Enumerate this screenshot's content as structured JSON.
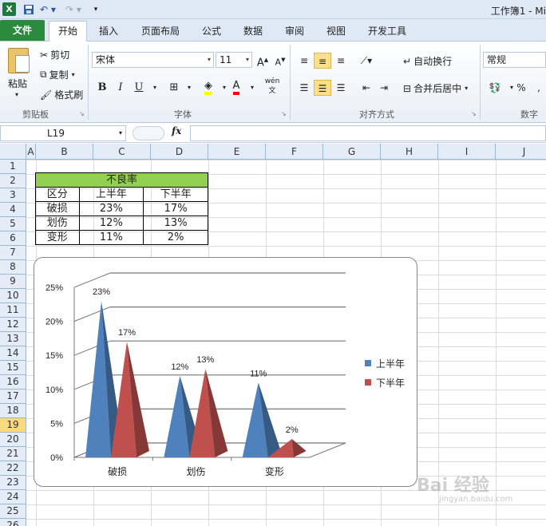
{
  "window": {
    "app_icon": "X",
    "title": "工作簿1 - Mi"
  },
  "ribbon_tabs": [
    "文件",
    "开始",
    "插入",
    "页面布局",
    "公式",
    "数据",
    "审阅",
    "视图",
    "开发工具"
  ],
  "clipboard": {
    "paste": "粘贴",
    "cut": "剪切",
    "copy": "复制",
    "format_painter": "格式刷",
    "label": "剪贴板"
  },
  "font": {
    "name": "宋体",
    "size": "11",
    "bold": "B",
    "italic": "I",
    "underline": "U",
    "phonetic": "wén",
    "label": "字体"
  },
  "alignment": {
    "wrap_text": "自动换行",
    "merge_center": "合并后居中",
    "label": "对齐方式"
  },
  "number": {
    "format": "常规",
    "label": "数字"
  },
  "formula_bar": {
    "name_box": "L19",
    "fx": "fx",
    "content": ""
  },
  "columns": [
    "A",
    "B",
    "C",
    "D",
    "E",
    "F",
    "G",
    "H",
    "I",
    "J"
  ],
  "rows": [
    "1",
    "2",
    "3",
    "4",
    "5",
    "6",
    "7",
    "8",
    "9",
    "10",
    "11",
    "12",
    "13",
    "14",
    "15",
    "16",
    "17",
    "18",
    "19",
    "20",
    "21",
    "22",
    "23",
    "24",
    "25",
    "26"
  ],
  "active_row": "19",
  "table": {
    "title": "不良率",
    "headers": [
      "区分",
      "上半年",
      "下半年"
    ],
    "rows": [
      [
        "破损",
        "23%",
        "17%"
      ],
      [
        "划伤",
        "12%",
        "13%"
      ],
      [
        "变形",
        "11%",
        "2%"
      ]
    ]
  },
  "chart_data": {
    "type": "bar",
    "categories": [
      "破损",
      "划伤",
      "变形"
    ],
    "series": [
      {
        "name": "上半年",
        "values": [
          23,
          12,
          11
        ],
        "labels": [
          "23%",
          "12%",
          "11%"
        ],
        "color": "#4f81bd"
      },
      {
        "name": "下半年",
        "values": [
          17,
          13,
          2
        ],
        "labels": [
          "17%",
          "13%",
          "2%"
        ],
        "color": "#c0504d"
      }
    ],
    "y_ticks": [
      "0%",
      "5%",
      "10%",
      "15%",
      "20%",
      "25%"
    ],
    "ylim": [
      0,
      25
    ],
    "legend": "right",
    "grid": true
  },
  "watermark": {
    "text": "Bai 经验",
    "sub": "jingyan.baidu.com"
  }
}
